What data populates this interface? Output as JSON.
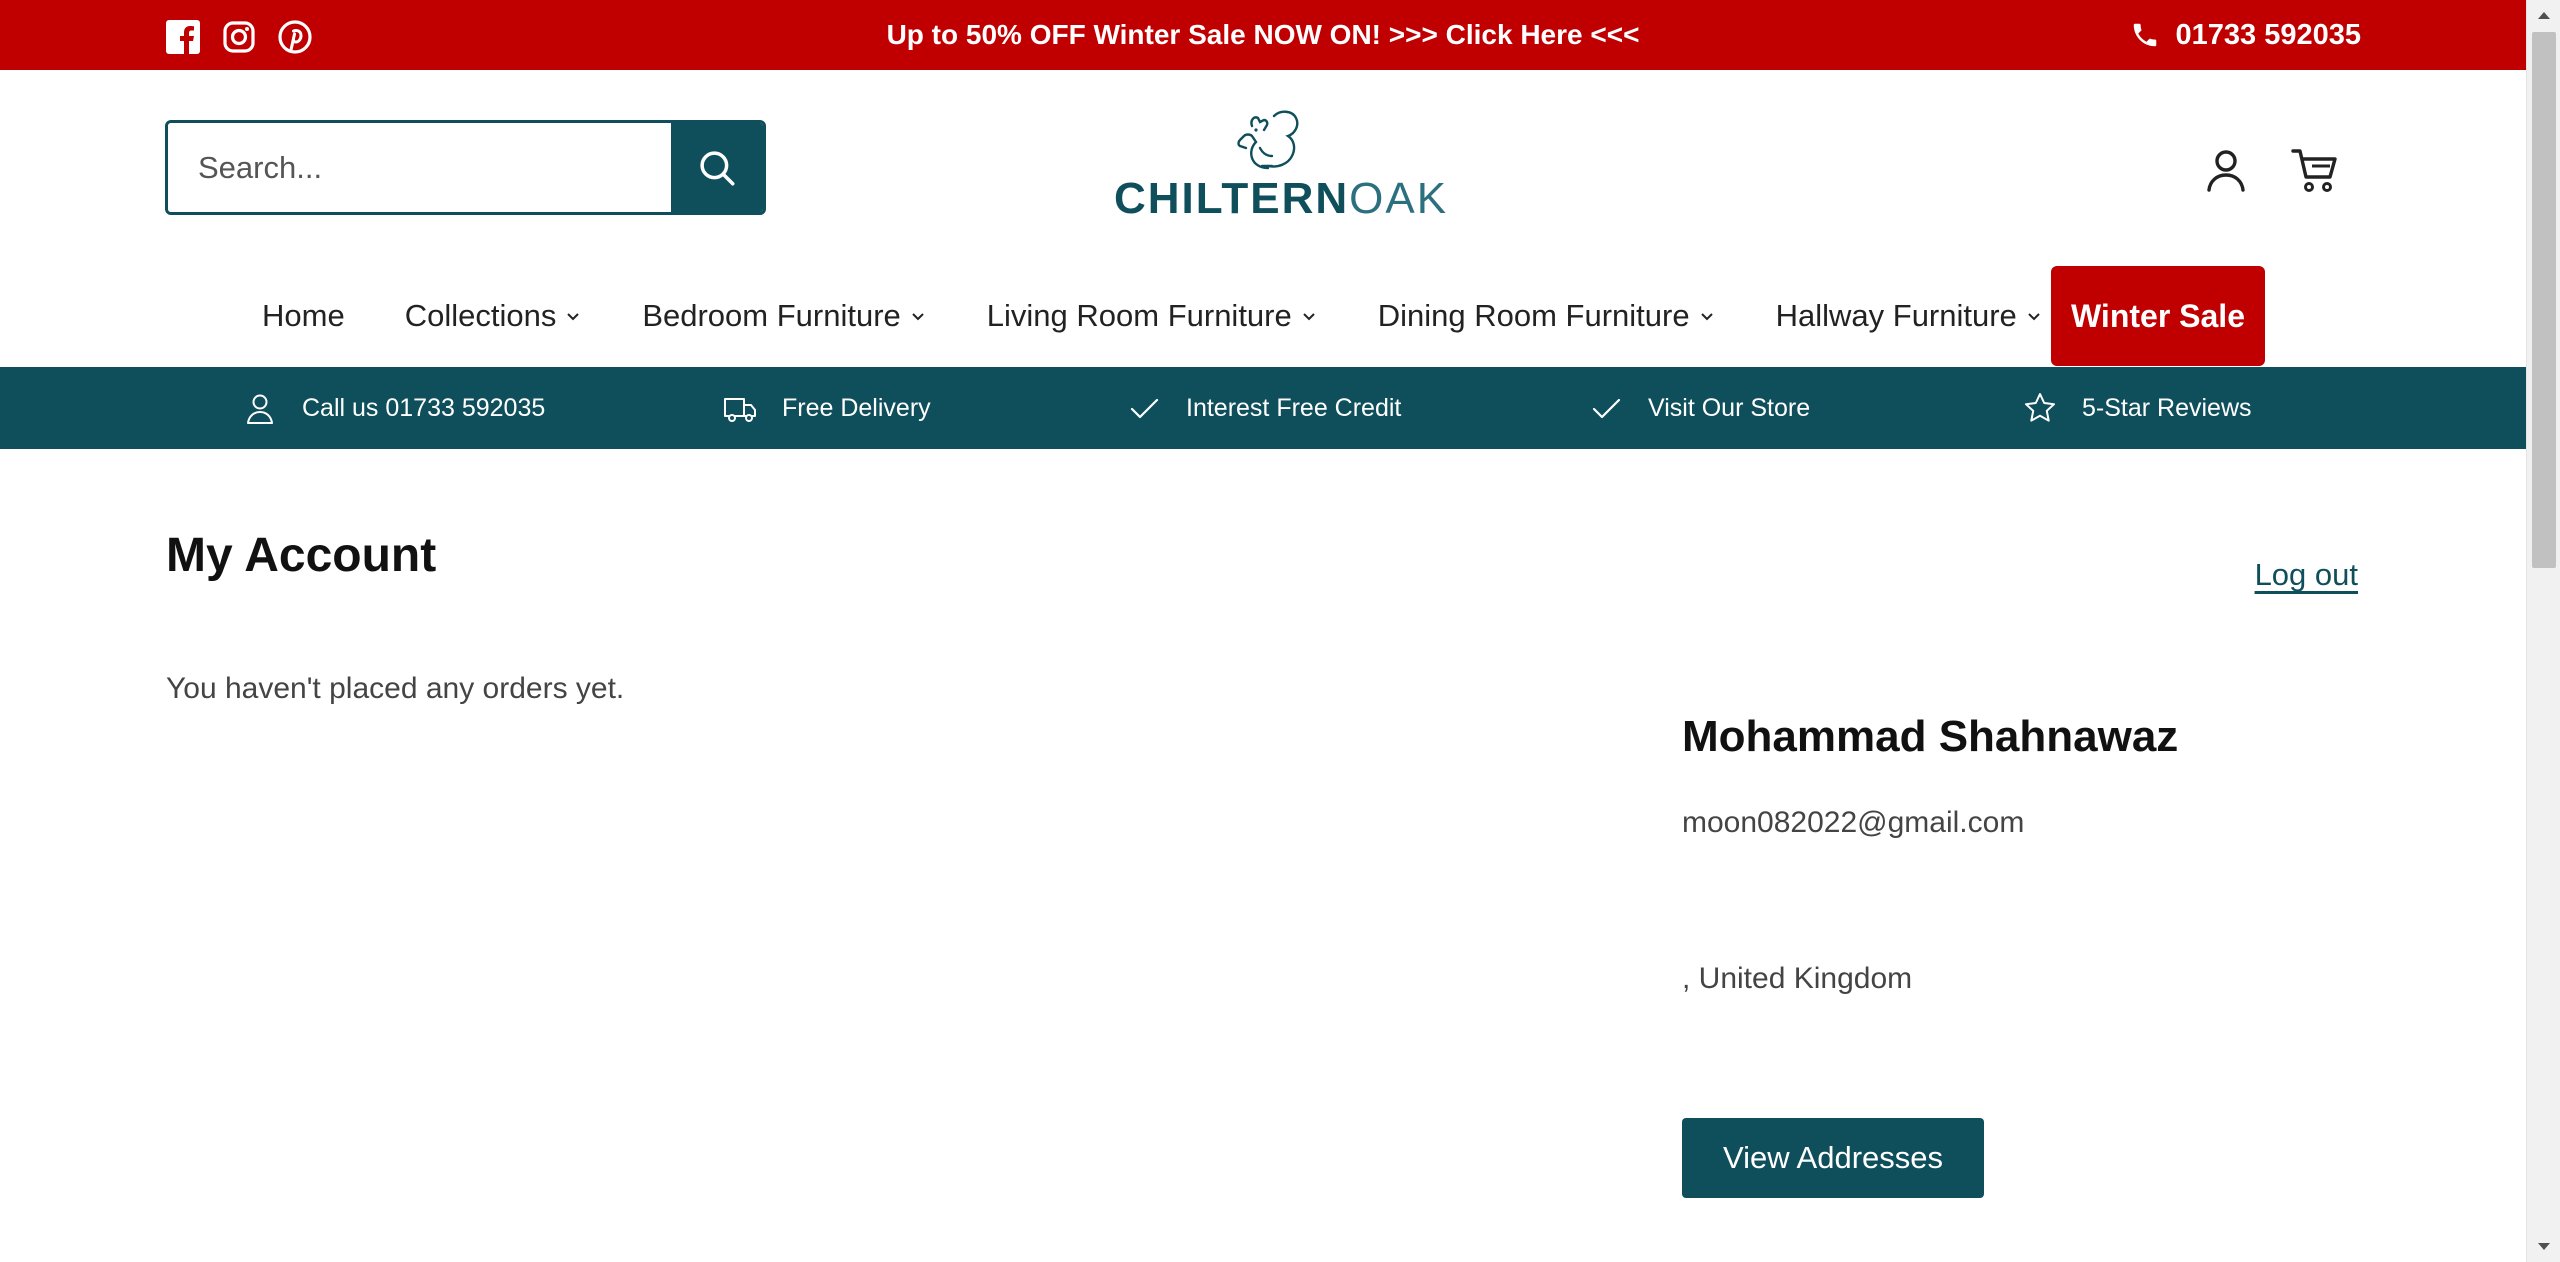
{
  "announcement": {
    "text": "Up to 50% OFF Winter Sale NOW ON! >>> Click Here <<<",
    "phone": "01733 592035",
    "social": [
      "facebook-icon",
      "instagram-icon",
      "pinterest-icon"
    ]
  },
  "header": {
    "search_placeholder": "Search...",
    "logo_bold": "CHILTERN",
    "logo_light": "OAK"
  },
  "nav": {
    "items": [
      {
        "label": "Home",
        "dropdown": false
      },
      {
        "label": "Collections",
        "dropdown": true
      },
      {
        "label": "Bedroom Furniture",
        "dropdown": true
      },
      {
        "label": "Living Room Furniture",
        "dropdown": true
      },
      {
        "label": "Dining Room Furniture",
        "dropdown": true
      },
      {
        "label": "Hallway Furniture",
        "dropdown": true
      }
    ],
    "sale_label": "Winter Sale"
  },
  "trust_bar": {
    "items": [
      {
        "label": "Call us 01733 592035",
        "icon": "user-icon"
      },
      {
        "label": "Free Delivery",
        "icon": "truck-icon"
      },
      {
        "label": "Interest Free Credit",
        "icon": "check-icon"
      },
      {
        "label": "Visit Our Store",
        "icon": "check-icon"
      },
      {
        "label": "5-Star Reviews",
        "icon": "star-icon"
      }
    ]
  },
  "account": {
    "title": "My Account",
    "logout": "Log out",
    "orders_empty": "You haven't placed any orders yet.",
    "customer_name": "Mohammad Shahnawaz",
    "customer_email": "moon082022@gmail.com",
    "customer_country": ", United Kingdom",
    "view_addresses": "View Addresses"
  },
  "colors": {
    "brand_red": "#c00000",
    "brand_teal": "#0f4f5c"
  }
}
